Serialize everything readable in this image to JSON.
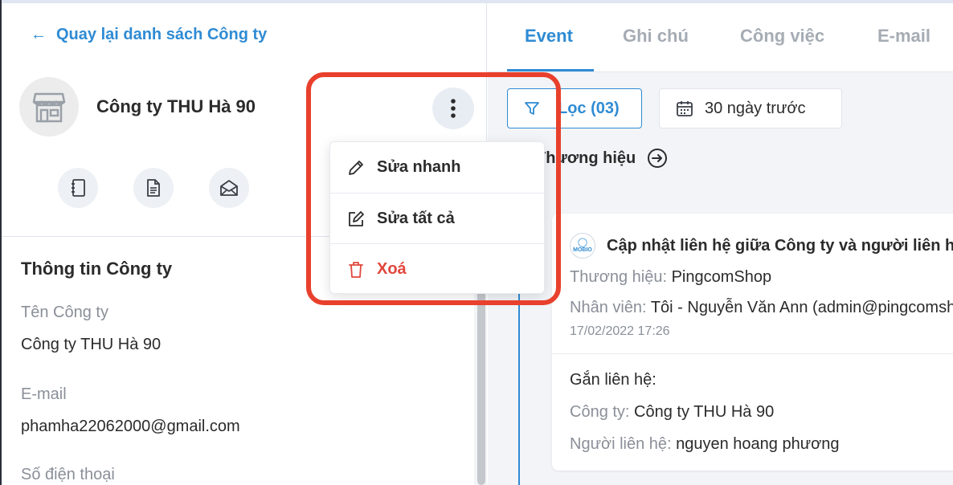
{
  "left_panel": {
    "back_link": "Quay lại danh sách Công ty",
    "company_name": "Công ty THU Hà 90",
    "info_section_title": "Thông tin Công ty",
    "fields": [
      {
        "label": "Tên Công ty",
        "value": "Công ty THU Hà 90"
      },
      {
        "label": "E-mail",
        "value": "phamha22062000@gmail.com"
      },
      {
        "label": "Số điện thoại",
        "value": ""
      }
    ],
    "icons": {
      "avatar": "storefront-icon",
      "more": "vertical-dots-icon",
      "actions": [
        "notebook-icon",
        "document-icon",
        "envelope-icon"
      ]
    }
  },
  "menu": {
    "items": [
      {
        "label": "Sửa nhanh",
        "icon": "pencil-icon"
      },
      {
        "label": "Sửa tất cả",
        "icon": "edit-square-icon"
      },
      {
        "label": "Xoá",
        "icon": "trash-icon",
        "danger": true
      }
    ]
  },
  "right_panel": {
    "tabs": [
      {
        "label": "Event",
        "active": true
      },
      {
        "label": "Ghi chú"
      },
      {
        "label": "Công việc"
      },
      {
        "label": "E-mail"
      }
    ],
    "filter_label": "Lọc (03)",
    "date_label": "30 ngày trước",
    "brand_row_label": "Thương hiệu",
    "event": {
      "title": "Cập nhật liên hệ giữa Công ty và người liên hệ",
      "logo_text": "MOBIO",
      "brand_key": "Thương hiệu:",
      "brand_value": "PingcomShop",
      "staff_key": "Nhân viên:",
      "staff_value": "Tôi - Nguyễn Văn Ann (admin@pingcomshop)",
      "time": "17/02/2022 17:26",
      "attach_heading": "Gắn liên hệ:",
      "company_key": "Công ty:",
      "company_value": "Công ty THU Hà 90",
      "contact_key": "Người liên hệ:",
      "contact_value": "nguyen hoang phương"
    }
  },
  "colors": {
    "accent": "#2f8bd3",
    "danger": "#e0463c",
    "highlight": "#e8402c"
  }
}
